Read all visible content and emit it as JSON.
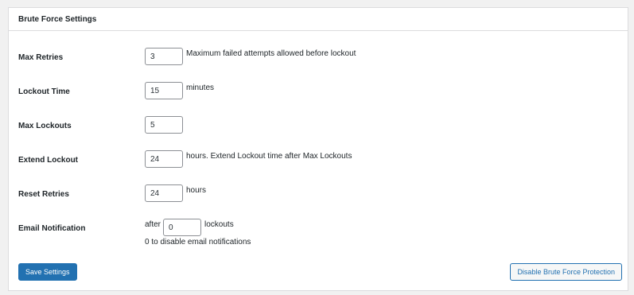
{
  "panel": {
    "title": "Brute Force Settings"
  },
  "settings": {
    "max_retries": {
      "label": "Max Retries",
      "value": "3",
      "suffix": "Maximum failed attempts allowed before lockout"
    },
    "lockout_time": {
      "label": "Lockout Time",
      "value": "15",
      "suffix": "minutes"
    },
    "max_lockouts": {
      "label": "Max Lockouts",
      "value": "5"
    },
    "extend_lockout": {
      "label": "Extend Lockout",
      "value": "24",
      "suffix": "hours. Extend Lockout time after Max Lockouts"
    },
    "reset_retries": {
      "label": "Reset Retries",
      "value": "24",
      "suffix": "hours"
    },
    "email_notification": {
      "label": "Email Notification",
      "prefix": "after",
      "value": "0",
      "suffix": "lockouts",
      "help": "0 to disable email notifications"
    }
  },
  "actions": {
    "save_label": "Save Settings",
    "disable_label": "Disable Brute Force Protection"
  },
  "colors": {
    "primary": "#2271b1",
    "border": "#dcdcde",
    "background": "#f1f1f1"
  }
}
